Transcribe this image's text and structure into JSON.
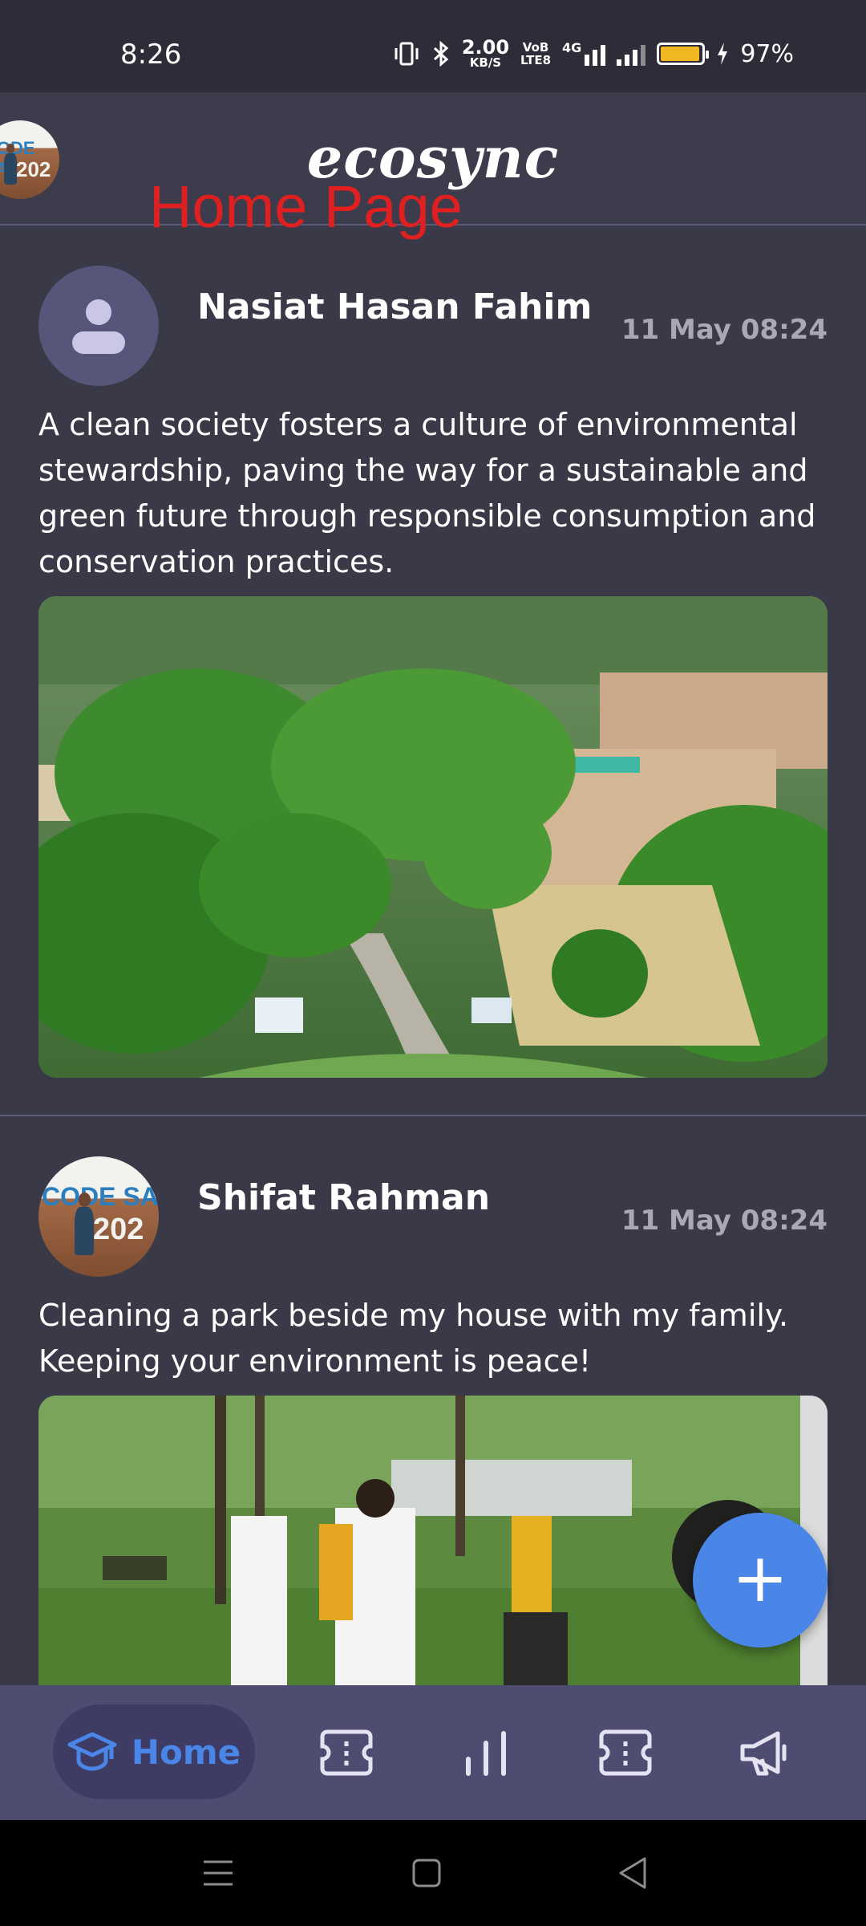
{
  "status_bar": {
    "time": "8:26",
    "net_speed": "2.00",
    "net_unit": "KB/S",
    "volte_top": "VoB",
    "volte_bottom": "LTE8",
    "network": "4G",
    "battery": "97%"
  },
  "header": {
    "logo": "ecosync",
    "overlay_label": "Home Page"
  },
  "posts": [
    {
      "author": "Nasiat Hasan Fahim",
      "date": "11 May 08:24",
      "text": "A clean society fosters a culture of environmental stewardship, paving the way for a sustainable and green future through responsible consumption and conservation practices.",
      "image": "campus-aerial-photo"
    },
    {
      "author": "Shifat Rahman",
      "date": "11 May 08:24",
      "text": "Cleaning a park beside my house with my family. Keeping your environment is peace!",
      "image": "park-people-photo"
    }
  ],
  "avatar_photo_text": {
    "top": "CODE SA",
    "bottom": "202"
  },
  "fab": {
    "label": "+"
  },
  "bottom_nav": {
    "items": [
      {
        "label": "Home",
        "icon": "graduation-cap-icon",
        "active": true
      },
      {
        "icon": "ticket-icon"
      },
      {
        "icon": "bar-chart-icon"
      },
      {
        "icon": "ticket-icon"
      },
      {
        "icon": "megaphone-icon"
      }
    ]
  },
  "colors": {
    "background": "#3a3948",
    "nav_background": "#4f4c72",
    "accent": "#4a86e8",
    "overlay_text": "#e02020"
  }
}
